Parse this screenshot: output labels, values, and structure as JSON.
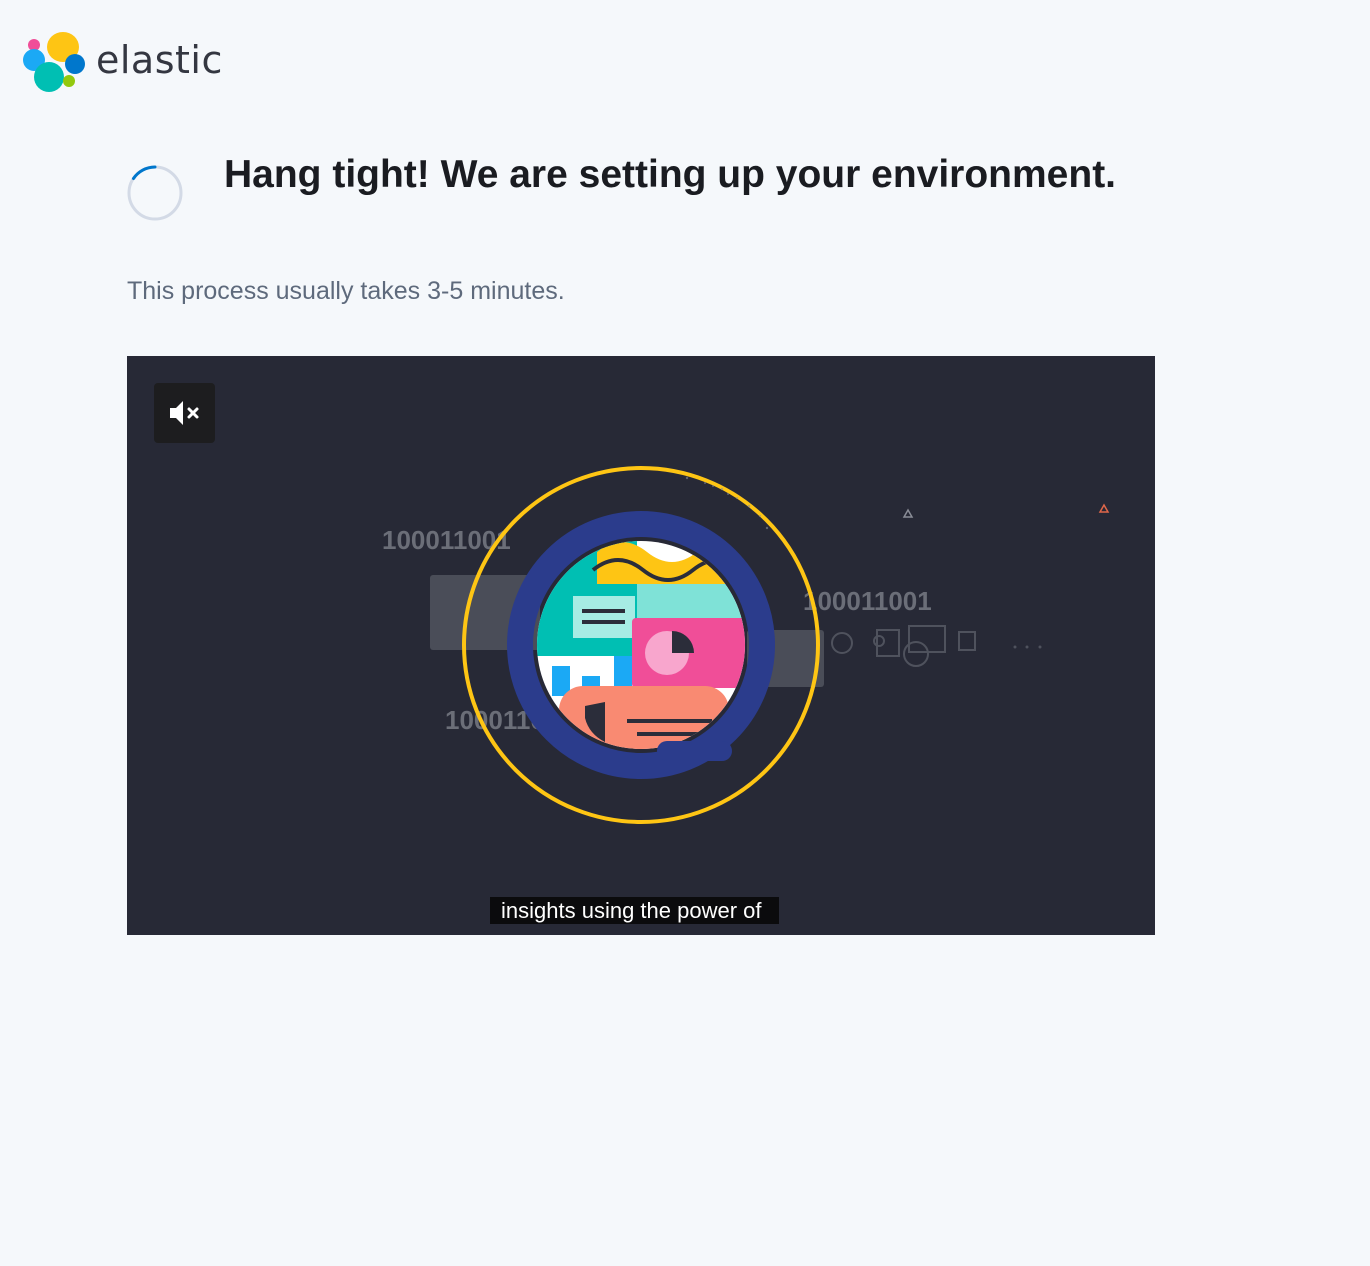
{
  "brand": {
    "name": "elastic",
    "colors": {
      "yellow": "#FEC514",
      "teal": "#00BFB3",
      "pink": "#F04E98",
      "blue": "#1BA9F5",
      "darkblue": "#0077CC",
      "green": "#93C90E"
    }
  },
  "loading": {
    "title": "Hang tight! We are setting up your environment.",
    "subtitle": "This process usually takes 3-5 minutes.",
    "spinner_icon": "loading-spinner-icon"
  },
  "video": {
    "mute_icon": "speaker-muted-icon",
    "muted": true,
    "binary_labels": [
      "100011001",
      "100011001",
      "1000110"
    ],
    "caption": "insights using the power of",
    "background": "#272936",
    "accent_colors": {
      "ring": "#FEC514",
      "lens": "#2B3C8C",
      "pink": "#F04E98",
      "teal": "#00BFB3",
      "salmon": "#F98A72"
    }
  }
}
